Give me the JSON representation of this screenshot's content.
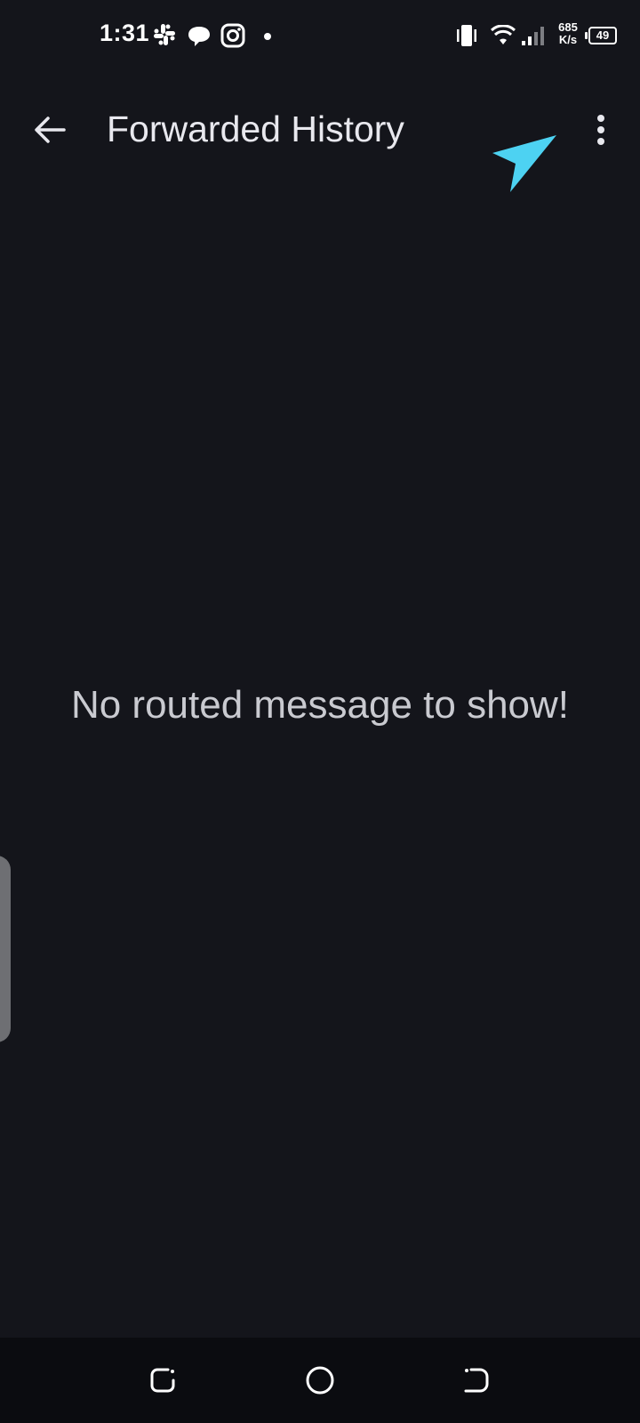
{
  "status_bar": {
    "time": "1:31",
    "net_speed_value": "685",
    "net_speed_unit": "K/s",
    "battery_level": "49",
    "icons": [
      "slack-icon",
      "chat-bubble-icon",
      "instagram-icon",
      "notification-dot-icon",
      "vibrate-icon",
      "wifi-icon",
      "signal-icon",
      "battery-icon"
    ]
  },
  "app_bar": {
    "title": "Forwarded History",
    "back_icon": "arrow-left-icon",
    "menu_icon": "more-vertical-icon"
  },
  "cursor": {
    "icon": "pointer-arrow-icon",
    "color": "#4dd2f2"
  },
  "empty_state": {
    "message": "No routed message to show!"
  },
  "nav_bar": {
    "icons": [
      "recents-icon",
      "home-icon",
      "back-nav-icon"
    ]
  },
  "colors": {
    "background": "#14151b",
    "nav_background": "#0b0c10",
    "text_primary": "#e8e8ee",
    "text_secondary": "#c9cad0",
    "side_handle": "#6e6f73",
    "accent_cursor": "#4dd2f2"
  }
}
